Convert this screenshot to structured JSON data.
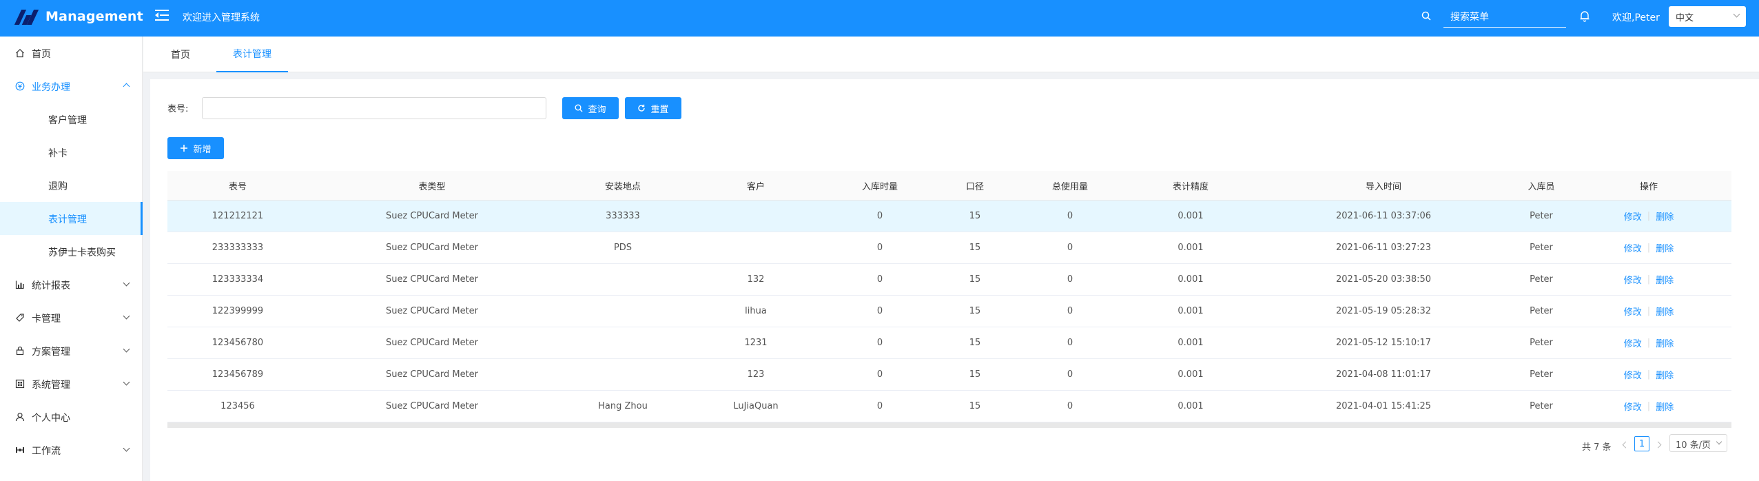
{
  "header": {
    "logo_text": "Management",
    "welcome_system": "欢迎进入管理系统",
    "search_placeholder": "搜索菜单",
    "user_greeting": "欢迎,Peter",
    "language": "中文"
  },
  "sidebar": {
    "items": [
      {
        "label": "首页",
        "icon": "home-icon"
      },
      {
        "label": "业务办理",
        "icon": "business-icon"
      },
      {
        "label": "客户管理"
      },
      {
        "label": "补卡"
      },
      {
        "label": "退购"
      },
      {
        "label": "表计管理"
      },
      {
        "label": "苏伊士卡表购买"
      },
      {
        "label": "统计报表",
        "icon": "chart-icon"
      },
      {
        "label": "卡管理",
        "icon": "card-icon"
      },
      {
        "label": "方案管理",
        "icon": "lock-icon"
      },
      {
        "label": "系统管理",
        "icon": "system-icon"
      },
      {
        "label": "个人中心",
        "icon": "user-icon"
      },
      {
        "label": "工作流",
        "icon": "workflow-icon"
      }
    ]
  },
  "tabs": [
    {
      "label": "首页"
    },
    {
      "label": "表计管理"
    }
  ],
  "search_form": {
    "label": "表号:",
    "query_button": "查询",
    "reset_button": "重置",
    "add_button": "新增"
  },
  "table": {
    "headers": [
      "表号",
      "表类型",
      "安装地点",
      "客户",
      "入库时量",
      "口径",
      "总使用量",
      "表计精度",
      "导入时间",
      "入库员",
      "操作"
    ],
    "edit_label": "修改",
    "delete_label": "删除",
    "rows": [
      [
        "121212121",
        "Suez CPUCard Meter",
        "333333",
        "",
        "0",
        "15",
        "0",
        "0.001",
        "2021-06-11 03:37:06",
        "Peter"
      ],
      [
        "233333333",
        "Suez CPUCard Meter",
        "PDS",
        "",
        "0",
        "15",
        "0",
        "0.001",
        "2021-06-11 03:27:23",
        "Peter"
      ],
      [
        "123333334",
        "Suez CPUCard Meter",
        "",
        "132",
        "0",
        "15",
        "0",
        "0.001",
        "2021-05-20 03:38:50",
        "Peter"
      ],
      [
        "122399999",
        "Suez CPUCard Meter",
        "",
        "lihua",
        "0",
        "15",
        "0",
        "0.001",
        "2021-05-19 05:28:32",
        "Peter"
      ],
      [
        "123456780",
        "Suez CPUCard Meter",
        "",
        "1231",
        "0",
        "15",
        "0",
        "0.001",
        "2021-05-12 15:10:17",
        "Peter"
      ],
      [
        "123456789",
        "Suez CPUCard Meter",
        "",
        "123",
        "0",
        "15",
        "0",
        "0.001",
        "2021-04-08 11:01:17",
        "Peter"
      ],
      [
        "123456",
        "Suez CPUCard Meter",
        "Hang Zhou",
        "LuJiaQuan",
        "0",
        "15",
        "0",
        "0.001",
        "2021-04-01 15:41:25",
        "Peter"
      ]
    ]
  },
  "pagination": {
    "total": "共 7 条",
    "current_page": "1",
    "page_size": "10 条/页"
  },
  "colors": {
    "primary": "#1890ff",
    "selected_row": "#e6f7ff"
  }
}
